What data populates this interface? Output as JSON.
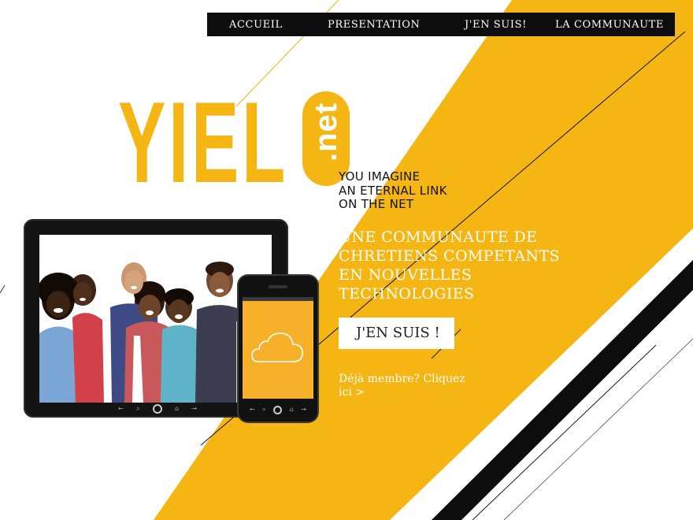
{
  "nav": {
    "items": [
      {
        "label": "ACCUEIL"
      },
      {
        "label": "PRESENTATION"
      },
      {
        "label": "J'EN SUIS!"
      },
      {
        "label": "LA COMMUNAUTE"
      }
    ]
  },
  "logo": {
    "word": "YIEL",
    "suffix": ".net"
  },
  "tagline": {
    "lines": [
      "YOU IMAGINE",
      "AN ETERNAL LINK",
      "ON THE NET"
    ]
  },
  "headline": {
    "lines": [
      "UNE COMMUNAUTE DE",
      "CHRETIENS COMPETANTS",
      "EN NOUVELLES",
      "TECHNOLOGIES"
    ]
  },
  "cta": {
    "label": "J'EN SUIS !"
  },
  "member_link": {
    "label": "Déjà membre? Cliquez ici >"
  },
  "colors": {
    "accent": "#f5b512",
    "dark": "#0d0d0d",
    "white": "#ffffff"
  },
  "icons": {
    "phone_screen": "cloud-icon",
    "device_home": "home-button-icon"
  }
}
